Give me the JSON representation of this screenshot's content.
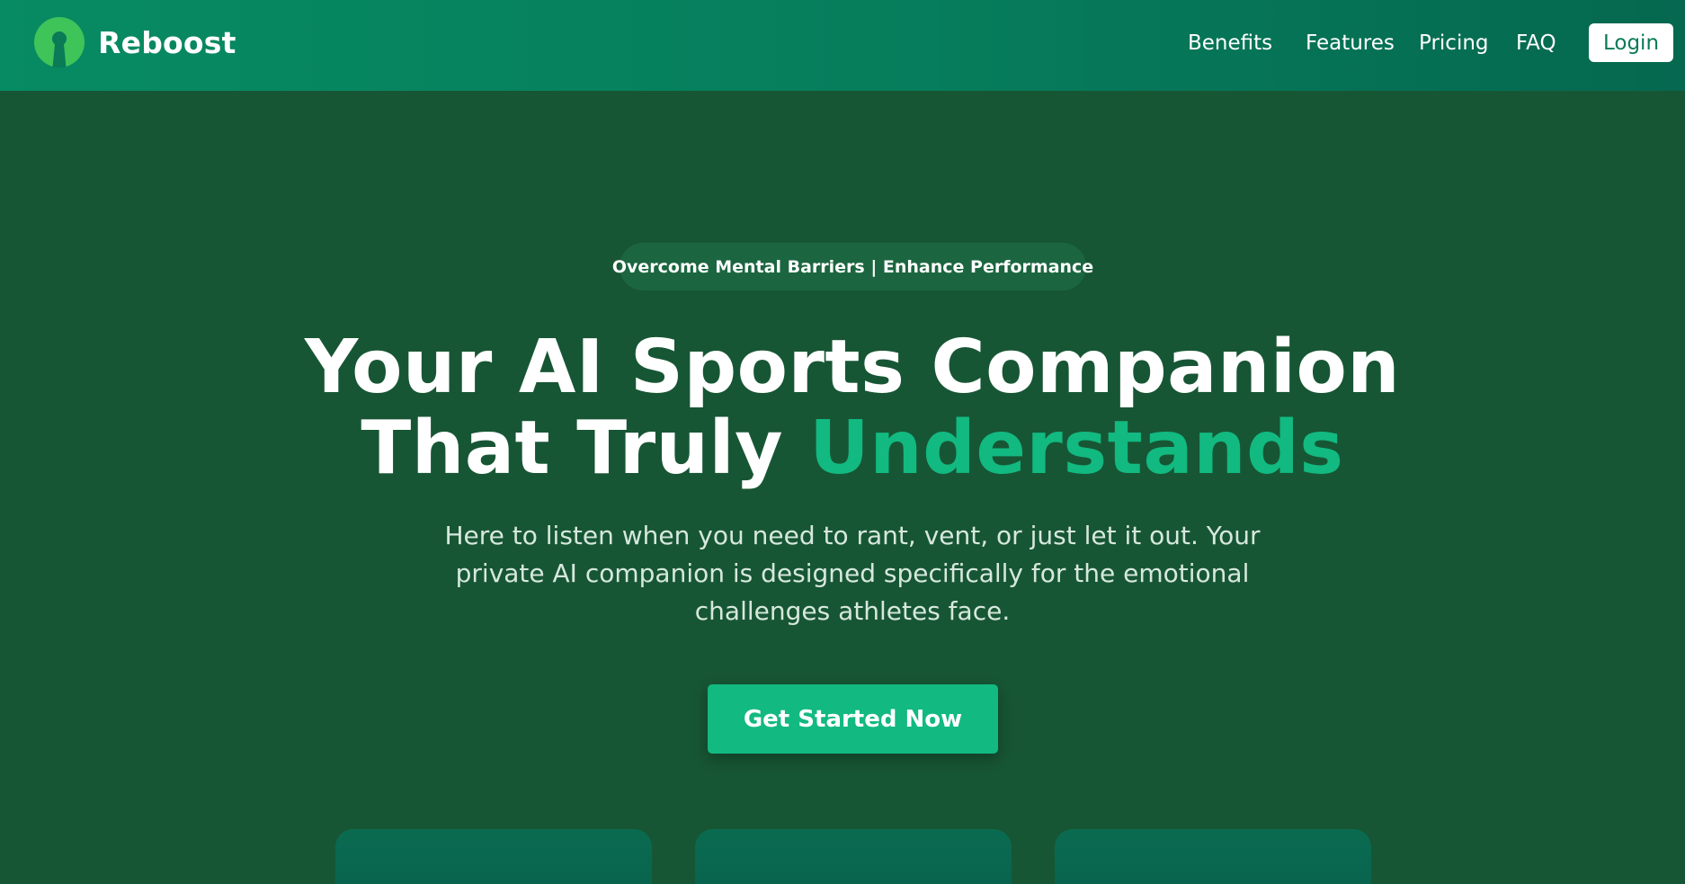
{
  "header": {
    "logo_text": "Reboost",
    "logo_icon": "keyhole-circle-icon",
    "nav": [
      {
        "label": "Benefits"
      },
      {
        "label": "Features"
      },
      {
        "label": "Pricing"
      },
      {
        "label": "FAQ"
      }
    ],
    "login_label": "Login"
  },
  "hero": {
    "tagline": "Overcome Mental Barriers | Enhance Performance",
    "headline_line1": "Your AI Sports Companion",
    "headline_line2_plain": "That Truly ",
    "headline_line2_accent": "Understands",
    "description": "Here to listen when you need to rant, vent, or just let it out. Your private AI companion is designed specifically for the emotional challenges athletes face.",
    "cta_label": "Get Started Now"
  },
  "colors": {
    "background": "#175634",
    "header_gradient_start": "#078b62",
    "header_gradient_end": "#05684f",
    "accent": "#12b981",
    "logo_green": "#3fc45a",
    "login_text": "#0b7a57"
  }
}
